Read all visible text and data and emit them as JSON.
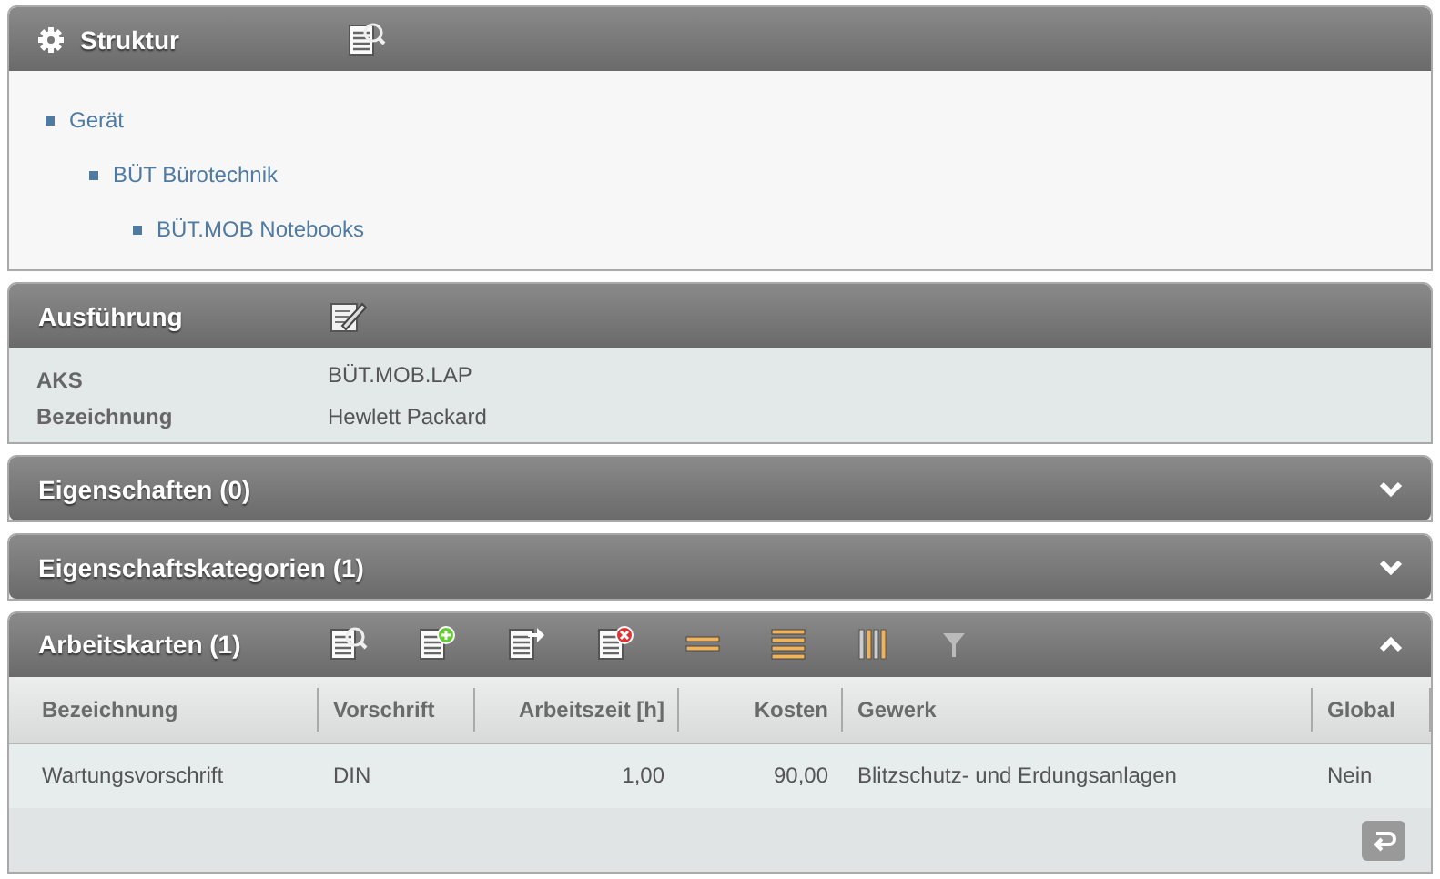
{
  "panels": [
    {
      "kind": "tree",
      "title": "Struktur",
      "tree": [
        {
          "label": "Gerät",
          "children": [
            {
              "label": "BÜT Bürotechnik",
              "children": [
                {
                  "label": "BÜT.MOB Notebooks"
                }
              ]
            }
          ]
        }
      ]
    },
    {
      "kind": "fields",
      "title": "Ausführung",
      "fields": [
        {
          "label": "AKS",
          "value": "BÜT.MOB.LAP"
        },
        {
          "label": "Bezeichnung",
          "value": "Hewlett Packard"
        }
      ]
    },
    {
      "kind": "collapsed",
      "title": "Eigenschaften (0)",
      "expanded": false
    },
    {
      "kind": "collapsed",
      "title": "Eigenschaftskategorien (1)",
      "expanded": false
    },
    {
      "kind": "table",
      "title": "Arbeitskarten (1)",
      "expanded": true,
      "columns": [
        "Bezeichnung",
        "Vorschrift",
        "Arbeitszeit [h]",
        "Kosten",
        "Gewerk",
        "Global"
      ],
      "rows": [
        [
          "Wartungsvorschrift",
          "DIN",
          "1,00",
          "90,00",
          "Blitzschutz- und Erdungsanlagen",
          "Nein"
        ]
      ]
    }
  ]
}
